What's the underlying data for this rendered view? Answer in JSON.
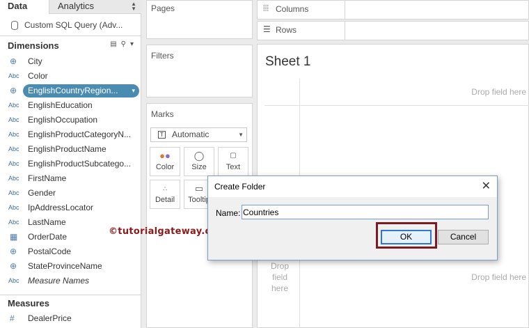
{
  "tabs": {
    "data": "Data",
    "analytics": "Analytics"
  },
  "datasource": "Custom SQL Query (Adv...",
  "dimensions_title": "Dimensions",
  "dimensions": [
    {
      "type": "globe",
      "label": "City"
    },
    {
      "type": "Abc",
      "label": "Color"
    },
    {
      "type": "globe",
      "label": "EnglishCountryRegion...",
      "selected": true
    },
    {
      "type": "Abc",
      "label": "EnglishEducation"
    },
    {
      "type": "Abc",
      "label": "EnglishOccupation"
    },
    {
      "type": "Abc",
      "label": "EnglishProductCategoryN..."
    },
    {
      "type": "Abc",
      "label": "EnglishProductName"
    },
    {
      "type": "Abc",
      "label": "EnglishProductSubcatego..."
    },
    {
      "type": "Abc",
      "label": "FirstName"
    },
    {
      "type": "Abc",
      "label": "Gender"
    },
    {
      "type": "Abc",
      "label": "IpAddressLocator"
    },
    {
      "type": "Abc",
      "label": "LastName"
    },
    {
      "type": "date",
      "label": "OrderDate"
    },
    {
      "type": "globe",
      "label": "PostalCode"
    },
    {
      "type": "globe",
      "label": "StateProvinceName"
    },
    {
      "type": "Abc",
      "label": "Measure Names",
      "italic": true
    }
  ],
  "measures_title": "Measures",
  "measures": [
    {
      "type": "#",
      "label": "DealerPrice"
    }
  ],
  "cards": {
    "pages": "Pages",
    "filters": "Filters",
    "marks": "Marks"
  },
  "marks_type": "Automatic",
  "mark_buttons": {
    "color": "Color",
    "size": "Size",
    "text": "Text",
    "detail": "Detail",
    "tooltip": "Tooltip"
  },
  "shelves": {
    "columns": "Columns",
    "rows": "Rows"
  },
  "sheet": {
    "title": "Sheet 1",
    "drop_top": "Drop field here",
    "drop_bottom": "Drop field here",
    "drop_left": [
      "Drop",
      "field",
      "here"
    ]
  },
  "watermark": "©tutorialgateway.org",
  "dialog": {
    "title": "Create Folder",
    "name_label": "Name:",
    "name_value": "Countries",
    "ok": "OK",
    "cancel": "Cancel",
    "close": "✕"
  },
  "colors": {
    "selected_pill": "#4a8cb1",
    "highlight_frame": "#7b1c22",
    "watermark": "#8b1a1a"
  }
}
